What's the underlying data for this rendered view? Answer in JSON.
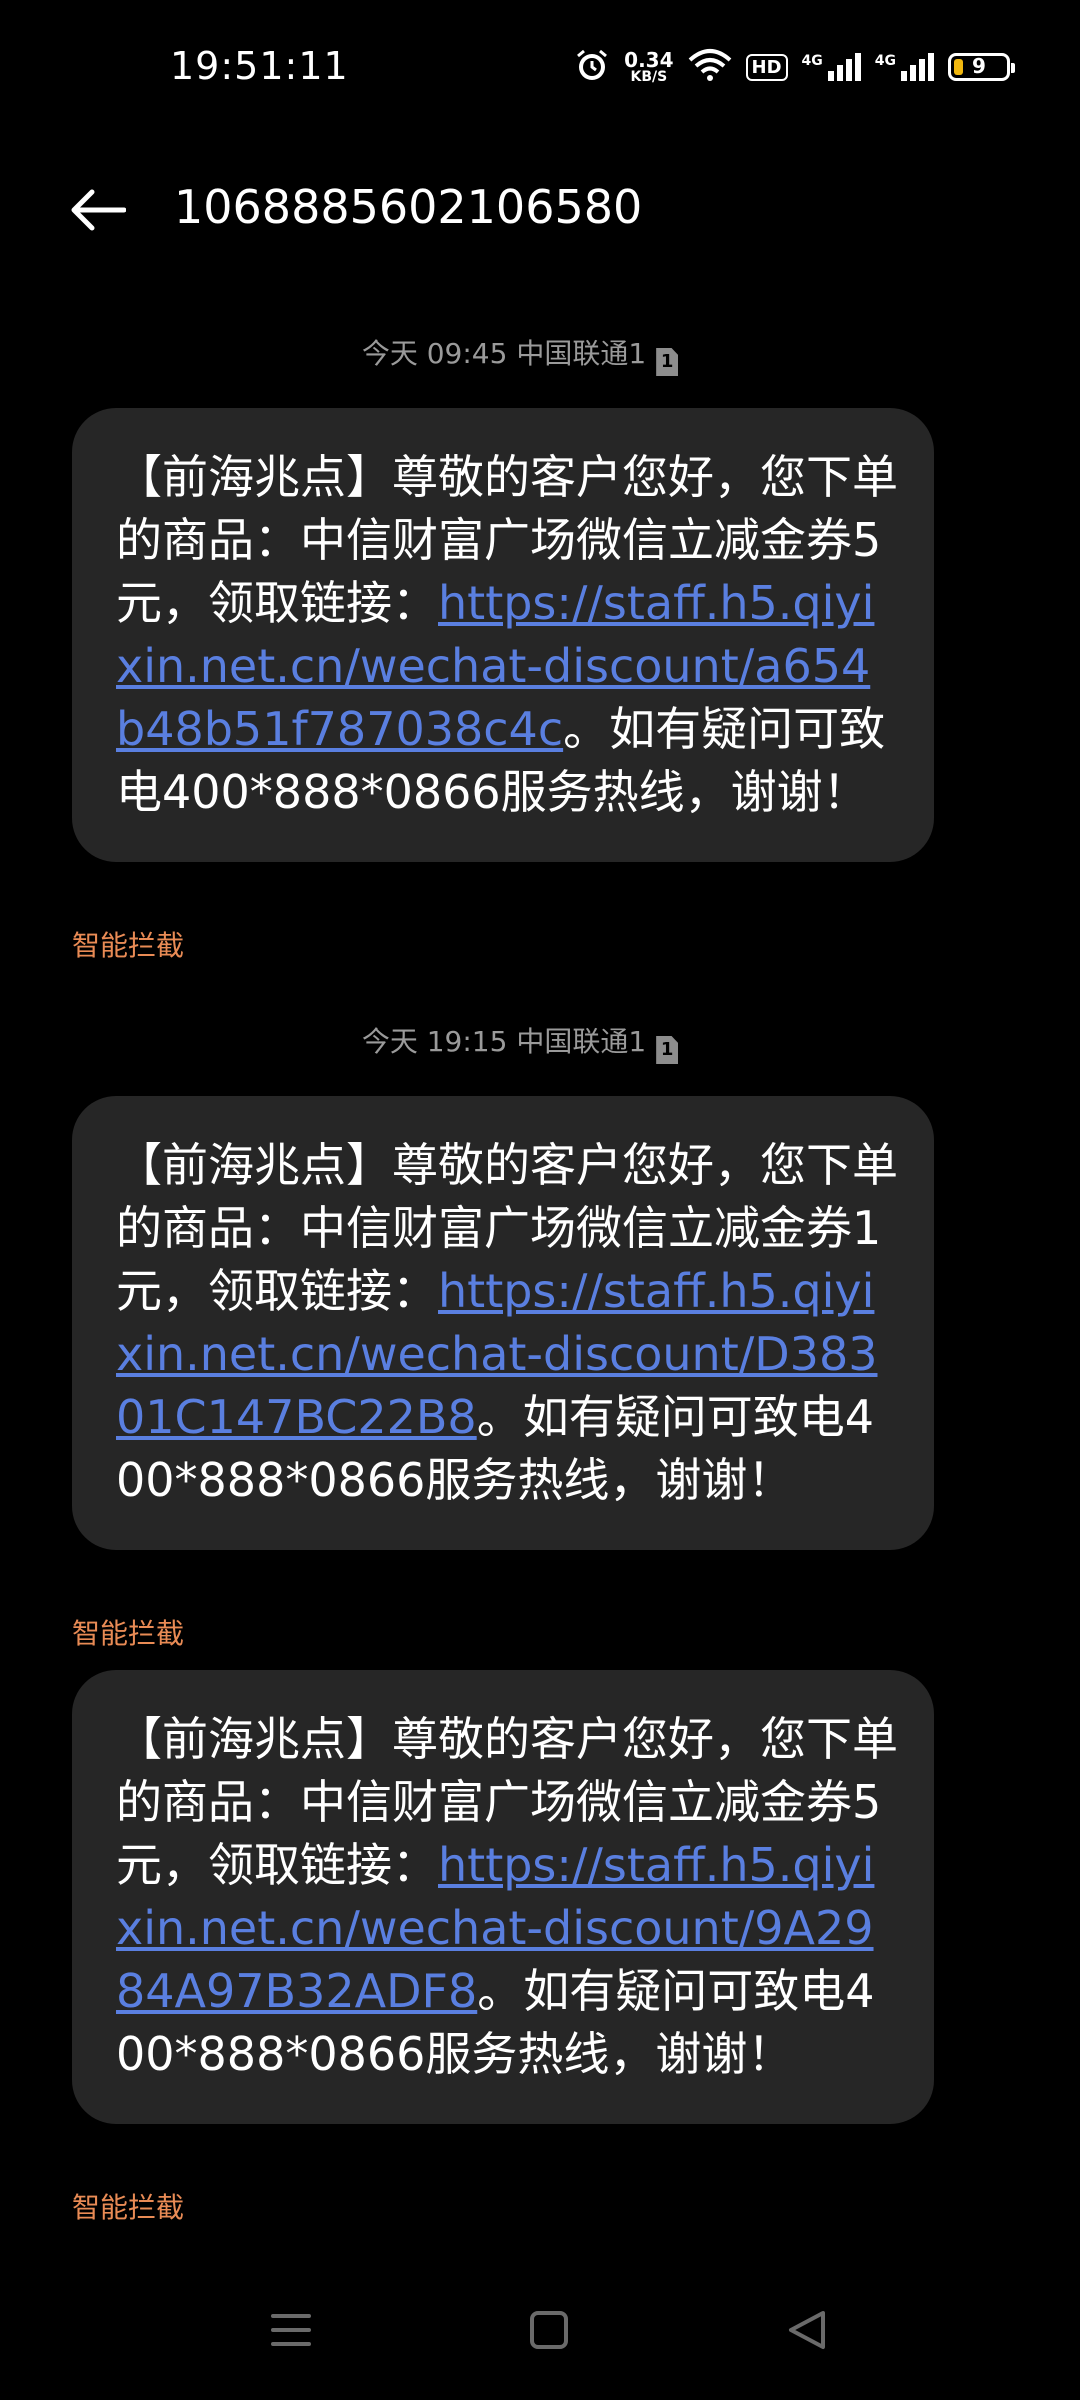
{
  "status_bar": {
    "time": "19:51:11",
    "speed_value": "0.34",
    "speed_unit": "KB/S",
    "hd_label": "HD",
    "net1": "4G",
    "net2": "4G",
    "battery_level": "9",
    "icons": [
      "alarm-icon",
      "wifi-icon",
      "signal-icon",
      "battery-icon"
    ]
  },
  "header": {
    "title": "1068885602106580",
    "back_icon": "back-arrow-icon"
  },
  "messages": [
    {
      "timestamp": "今天 09:45 中国联通1",
      "sim": "1",
      "text_before": "【前海兆点】尊敬的客户您好，您下单的商品：中信财富广场微信立减金券5元，领取链接：",
      "link": "https://staff.h5.qiyixin.net.cn/wechat-discount/a654b48b51f787038c4c",
      "text_after": "。如有疑问可致电400*888*0866服务热线，谢谢！",
      "tag": "智能拦截"
    },
    {
      "timestamp": "今天 19:15 中国联通1",
      "sim": "1",
      "text_before": "【前海兆点】尊敬的客户您好，您下单的商品：中信财富广场微信立减金券1元，领取链接：",
      "link": "https://staff.h5.qiyixin.net.cn/wechat-discount/D38301C147BC22B8",
      "text_after": "。如有疑问可致电400*888*0866服务热线，谢谢！",
      "tag": "智能拦截"
    },
    {
      "text_before": "【前海兆点】尊敬的客户您好，您下单的商品：中信财富广场微信立减金券5元，领取链接：",
      "link": "https://staff.h5.qiyixin.net.cn/wechat-discount/9A2984A97B32ADF8",
      "text_after": "。如有疑问可致电400*888*0866服务热线，谢谢！",
      "tag": "智能拦截"
    }
  ],
  "colors": {
    "background": "#000000",
    "bubble": "#262626",
    "link": "#5a7fe0",
    "intercept_tag": "#e98b55",
    "timestamp": "#9a9a9a",
    "battery_fill": "#f2b80f"
  },
  "navbar": {
    "buttons": [
      "menu-icon",
      "home-icon",
      "back-triangle-icon"
    ]
  }
}
